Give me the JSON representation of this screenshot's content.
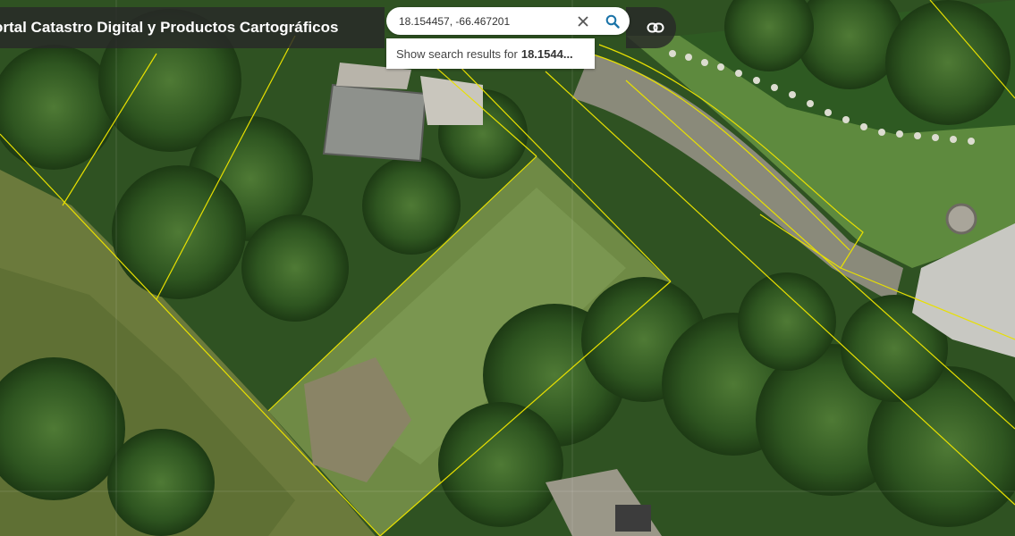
{
  "app": {
    "title": "ortal Catastro Digital y Productos Cartográficos"
  },
  "search": {
    "value": "18.154457, -66.467201",
    "placeholder": "",
    "clear_icon": "close-icon",
    "search_icon": "search-icon"
  },
  "suggestion": {
    "prefix": "Show search results for",
    "query": "18.1544..."
  },
  "toolbar": {
    "link_icon": "link-icon"
  },
  "colors": {
    "parcel_lines": "#e8e000",
    "accent": "#1a73a8",
    "title_bar": "#282828"
  }
}
